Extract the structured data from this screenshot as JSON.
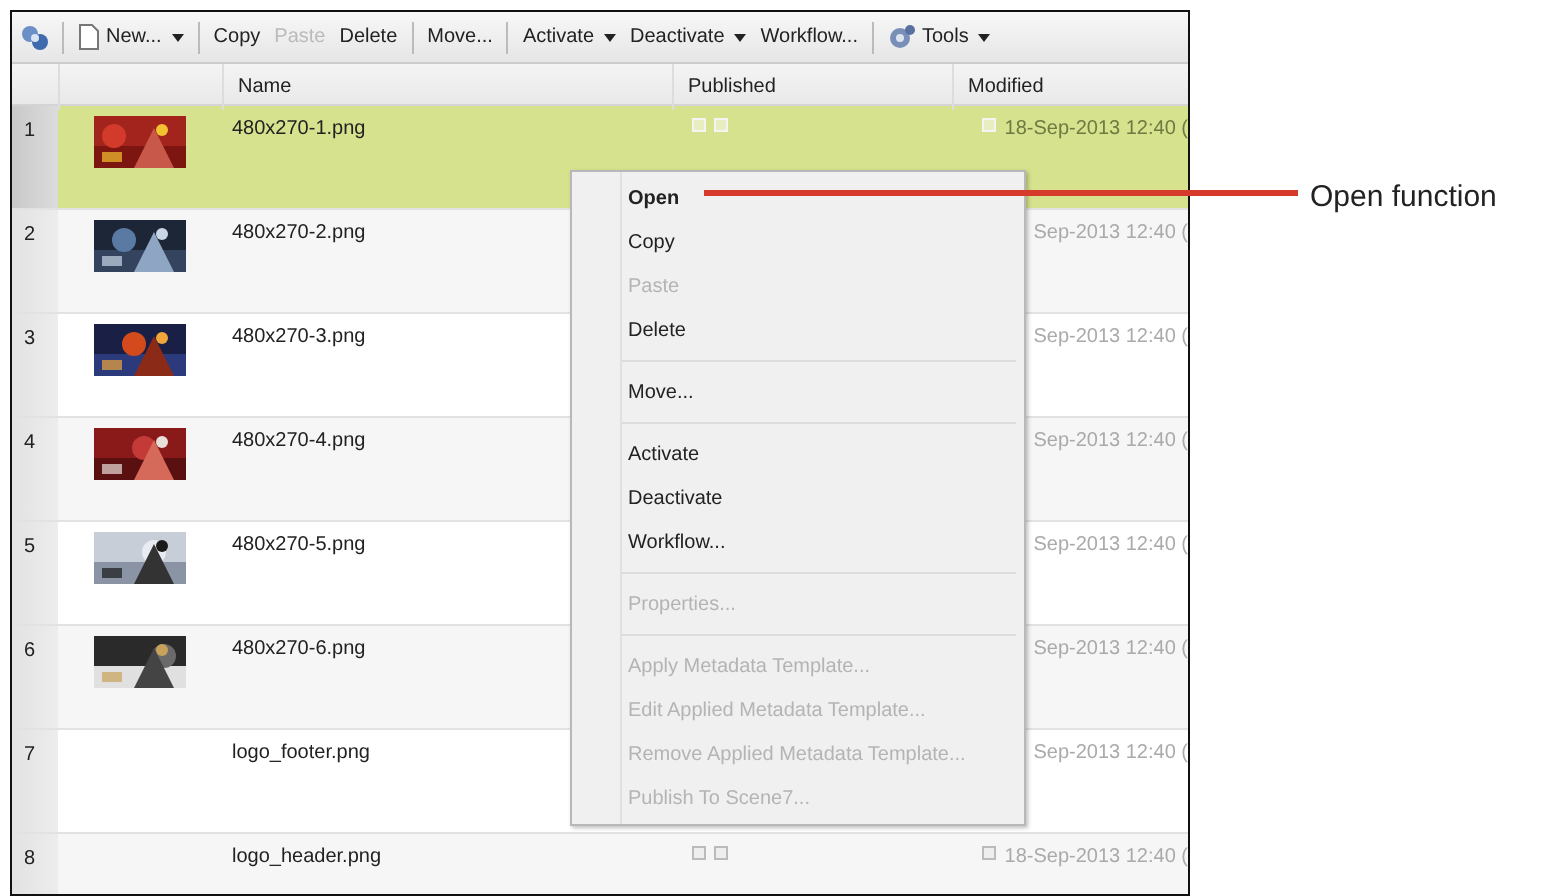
{
  "toolbar": {
    "groups": [
      [
        {
          "kind": "logo"
        }
      ],
      [
        {
          "kind": "doc",
          "label": "New...",
          "dropdown": true,
          "disabled": false
        }
      ],
      [
        {
          "kind": "plain",
          "label": "Copy",
          "dropdown": false,
          "disabled": false
        },
        {
          "kind": "plain",
          "label": "Paste",
          "dropdown": false,
          "disabled": true
        },
        {
          "kind": "plain",
          "label": "Delete",
          "dropdown": false,
          "disabled": false
        }
      ],
      [
        {
          "kind": "plain",
          "label": "Move...",
          "dropdown": false,
          "disabled": false
        }
      ],
      [
        {
          "kind": "plain",
          "label": "Activate",
          "dropdown": true,
          "disabled": false
        },
        {
          "kind": "plain",
          "label": "Deactivate",
          "dropdown": true,
          "disabled": false
        },
        {
          "kind": "plain",
          "label": "Workflow...",
          "dropdown": false,
          "disabled": false
        }
      ],
      [
        {
          "kind": "gear",
          "label": "Tools",
          "dropdown": true,
          "disabled": false
        }
      ]
    ]
  },
  "table": {
    "columns": [
      {
        "label": "Name"
      },
      {
        "label": "Published"
      },
      {
        "label": "Modified"
      }
    ],
    "rows": [
      {
        "number": "1",
        "selected": true,
        "name": "480x270-1.png",
        "status_icons": true,
        "modified": "18-Sep-2013 12:40 ("
      },
      {
        "number": "2",
        "selected": false,
        "name": "480x270-2.png",
        "modified": "Sep-2013 12:40 ("
      },
      {
        "number": "3",
        "selected": false,
        "name": "480x270-3.png",
        "modified": "Sep-2013 12:40 ("
      },
      {
        "number": "4",
        "selected": false,
        "name": "480x270-4.png",
        "modified": "Sep-2013 12:40 ("
      },
      {
        "number": "5",
        "selected": false,
        "name": "480x270-5.png",
        "modified": "Sep-2013 12:40 ("
      },
      {
        "number": "6",
        "selected": false,
        "name": "480x270-6.png",
        "modified": "Sep-2013 12:40 ("
      },
      {
        "number": "7",
        "selected": false,
        "name": "logo_footer.png",
        "modified": "Sep-2013 12:40 ("
      },
      {
        "number": "8",
        "selected": false,
        "name": "logo_header.png",
        "status_icons": true,
        "modified": "18-Sep-2013 12:40 ("
      }
    ]
  },
  "context_menu": {
    "groups": [
      [
        {
          "label": "Open",
          "default": true,
          "disabled": false
        },
        {
          "label": "Copy",
          "default": false,
          "disabled": false
        },
        {
          "label": "Paste",
          "default": false,
          "disabled": true
        },
        {
          "label": "Delete",
          "default": false,
          "disabled": false
        }
      ],
      [
        {
          "label": "Move...",
          "default": false,
          "disabled": false
        }
      ],
      [
        {
          "label": "Activate",
          "default": false,
          "disabled": false
        },
        {
          "label": "Deactivate",
          "default": false,
          "disabled": false
        },
        {
          "label": "Workflow...",
          "default": false,
          "disabled": false
        }
      ],
      [
        {
          "label": "Properties...",
          "default": false,
          "disabled": true
        }
      ],
      [
        {
          "label": "Apply Metadata Template...",
          "default": false,
          "disabled": true
        },
        {
          "label": "Edit Applied Metadata Template...",
          "default": false,
          "disabled": true
        },
        {
          "label": "Remove Applied Metadata Template...",
          "default": false,
          "disabled": true
        },
        {
          "label": "Publish To Scene7...",
          "default": false,
          "disabled": true
        }
      ]
    ]
  },
  "callout": {
    "label": "Open function"
  }
}
